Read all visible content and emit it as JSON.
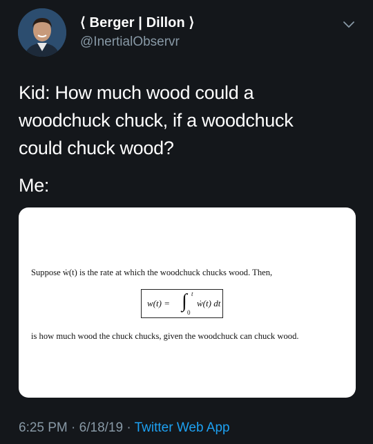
{
  "header": {
    "display_name": "⟨ Berger | Dillon ⟩",
    "handle": "@InertialObservr",
    "menu_icon": "chevron-down-icon"
  },
  "tweet": {
    "line1": "Kid: How much wood could a",
    "line2": "woodchuck chuck, if a woodchuck",
    "line3": "could chuck wood?",
    "line4": "Me:"
  },
  "card": {
    "text_before": "Suppose ẇ(t) is the rate at which the woodchuck chucks wood. Then,",
    "equation_lhs": "w(t) =",
    "integral_upper": "t",
    "integral_lower": "0",
    "integrand": "ẇ(t) dt",
    "text_after": "is how much wood the chuck chucks, given the woodchuck can chuck wood."
  },
  "footer": {
    "time": "6:25 PM",
    "date": "6/18/19",
    "separator": "·",
    "app": "Twitter Web App"
  },
  "colors": {
    "background": "#14171b",
    "secondary_text": "#8899a6",
    "link": "#1da1f2"
  }
}
